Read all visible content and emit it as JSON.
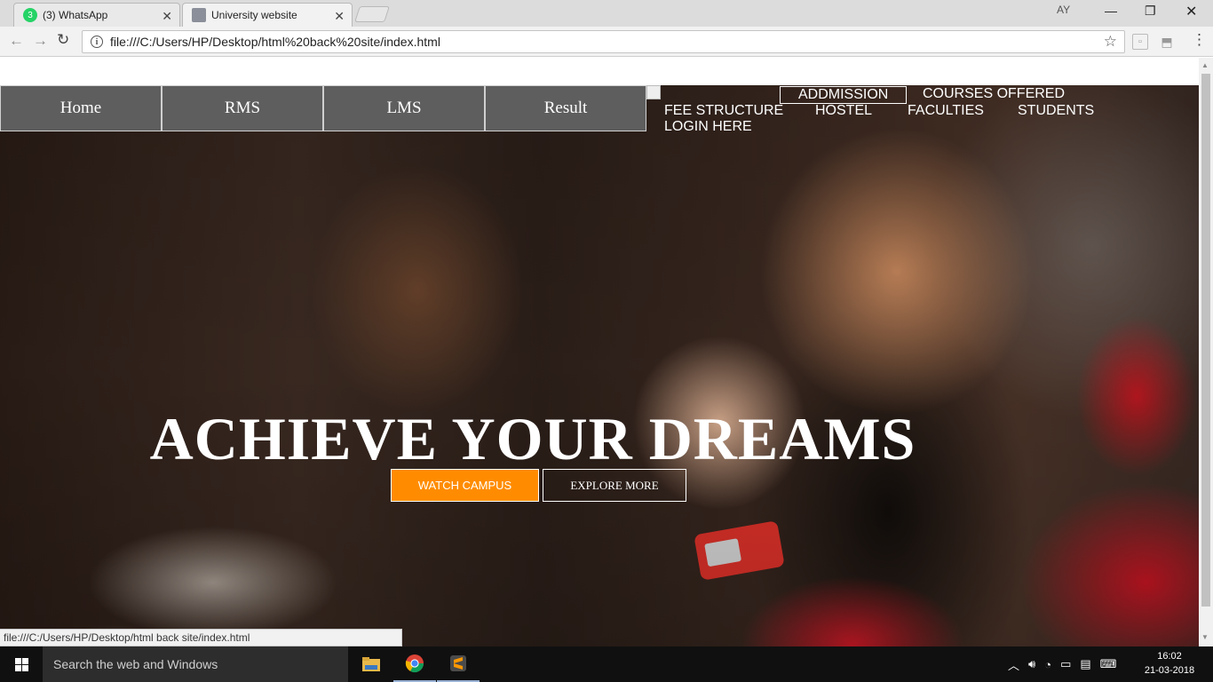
{
  "browser": {
    "tabs": [
      {
        "title": "(3) WhatsApp",
        "badge": "3",
        "active": false
      },
      {
        "title": "University website",
        "active": true
      }
    ],
    "profile": "AY",
    "address": "file:///C:/Users/HP/Desktop/html%20back%20site/index.html",
    "status_url": "file:///C:/Users/HP/Desktop/html back site/index.html"
  },
  "page": {
    "menu_boxes": [
      "Home",
      "RMS",
      "LMS",
      "Result"
    ],
    "nav_links": {
      "admission": "ADDMISSION",
      "courses": "COURSES OFFERED",
      "fee": "FEE STRUCTURE",
      "hostel": "HOSTEL",
      "faculties": "FACULTIES",
      "students": "STUDENTS",
      "login": "LOGIN HERE"
    },
    "hero": {
      "title": "ACHIEVE YOUR DREAMS",
      "watch_button": "WATCH CAMPUS",
      "explore_button": "EXPLORE MORE"
    }
  },
  "taskbar": {
    "search_placeholder": "Search the web and Windows",
    "time": "16:02",
    "date": "21-03-2018"
  },
  "colors": {
    "accent_orange": "#ff8c00",
    "menu_box_bg": "#5e5e5e",
    "whatsapp_green": "#25d366"
  }
}
